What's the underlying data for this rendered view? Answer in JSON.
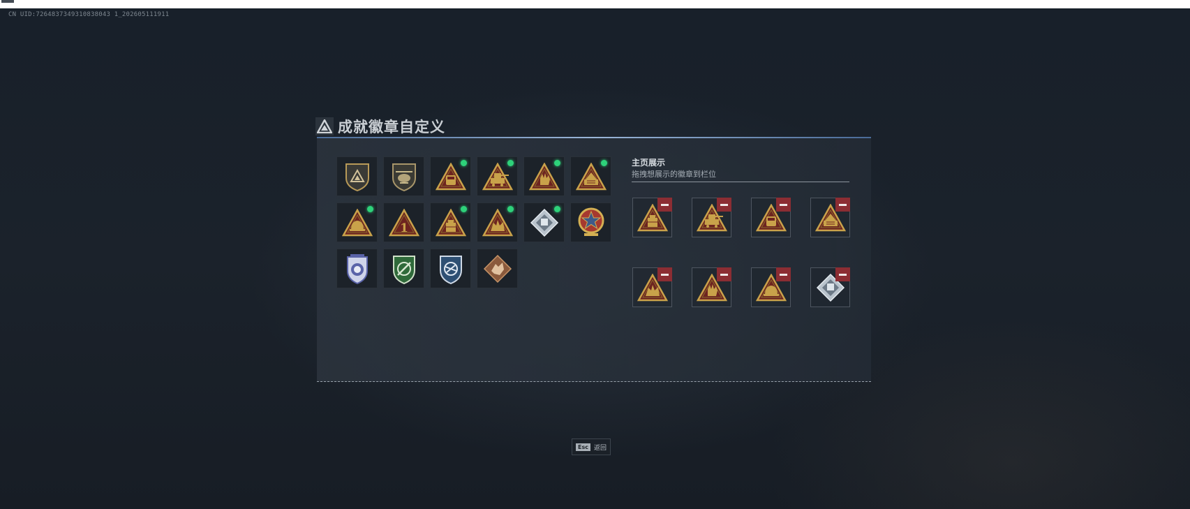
{
  "uid_text": "CN UID:7264837349310838043 1_202605111911",
  "header": {
    "title": "成就徽章自定义"
  },
  "sidebar": {
    "title": "主页展示",
    "subtitle": "拖拽想展示的徽章到栏位"
  },
  "footer": {
    "esc_key": "Esc",
    "esc_label": "返回"
  },
  "badges": [
    {
      "icon": "shield-badge-icon",
      "new": false
    },
    {
      "icon": "helicopter-shield-badge-icon",
      "new": false
    },
    {
      "icon": "truck-triangle-badge-icon",
      "new": true
    },
    {
      "icon": "turret-triangle-badge-icon",
      "new": true
    },
    {
      "icon": "hand-triangle-badge-icon",
      "new": true
    },
    {
      "icon": "rocket-triangle-badge-icon",
      "new": true
    },
    {
      "icon": "helmet-triangle-badge-icon",
      "new": true
    },
    {
      "icon": "number-one-triangle-badge-icon",
      "new": false
    },
    {
      "icon": "crate-triangle-badge-icon",
      "new": true
    },
    {
      "icon": "wolf-triangle-badge-icon",
      "new": true
    },
    {
      "icon": "silver-diamond-badge-icon",
      "new": true
    },
    {
      "icon": "star-medal-badge-icon",
      "new": false
    },
    {
      "icon": "police-shield-badge-icon",
      "new": false
    },
    {
      "icon": "green-shield-badge-icon",
      "new": false
    },
    {
      "icon": "blue-shield-badge-icon",
      "new": false
    },
    {
      "icon": "dragon-diamond-badge-icon",
      "new": false
    }
  ],
  "showcase": [
    {
      "icon": "crate-triangle-badge-icon"
    },
    {
      "icon": "turret-triangle-badge-icon"
    },
    {
      "icon": "truck-triangle-badge-icon"
    },
    {
      "icon": "rocket-triangle-badge-icon"
    },
    {
      "icon": "wolf-triangle-badge-icon"
    },
    {
      "icon": "hand-triangle-badge-icon"
    },
    {
      "icon": "helmet-triangle-badge-icon"
    },
    {
      "icon": "silver-diamond-badge-icon"
    }
  ],
  "colors": {
    "gold": "#c9a24a",
    "crimson": "#6e2420",
    "new_dot": "#2ed27a",
    "remove_button": "#8c2d33"
  }
}
